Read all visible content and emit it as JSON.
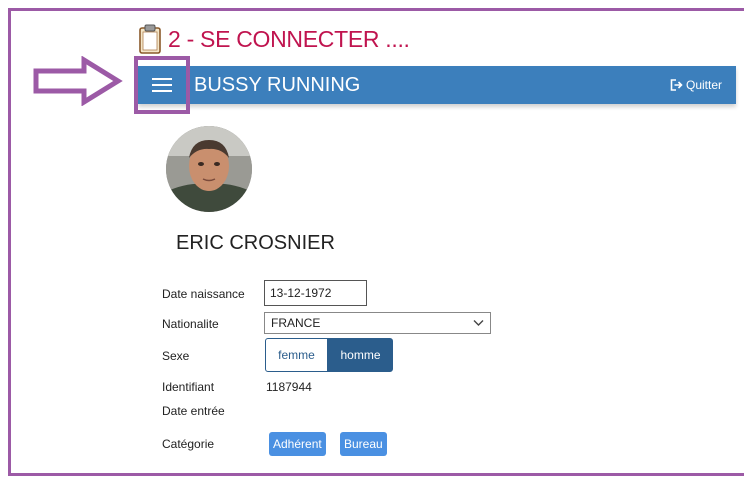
{
  "step": {
    "title": "2 - SE CONNECTER ....",
    "icon": "clipboard-icon",
    "color": "#c0144f"
  },
  "annotation": {
    "arrow_icon": "arrow-right-outline-icon",
    "color": "#9c5aa6"
  },
  "topbar": {
    "menu_icon": "hamburger-icon",
    "brand": "BUSSY RUNNING",
    "quit_label": "Quitter",
    "quit_icon": "sign-out-icon",
    "background": "#3c7fbc"
  },
  "profile": {
    "avatar": "avatar",
    "name": "ERIC CROSNIER",
    "fields": {
      "birthdate_label": "Date naissance",
      "birthdate_value": "13-12-1972",
      "nationality_label": "Nationalite",
      "nationality_value": "FRANCE",
      "sex_label": "Sexe",
      "sex_options": [
        "femme",
        "homme"
      ],
      "sex_selected": "homme",
      "id_label": "Identifiant",
      "id_value": "1187944",
      "entry_date_label": "Date entrée",
      "category_label": "Catégorie",
      "categories": [
        "Adhérent",
        "Bureau"
      ]
    }
  }
}
